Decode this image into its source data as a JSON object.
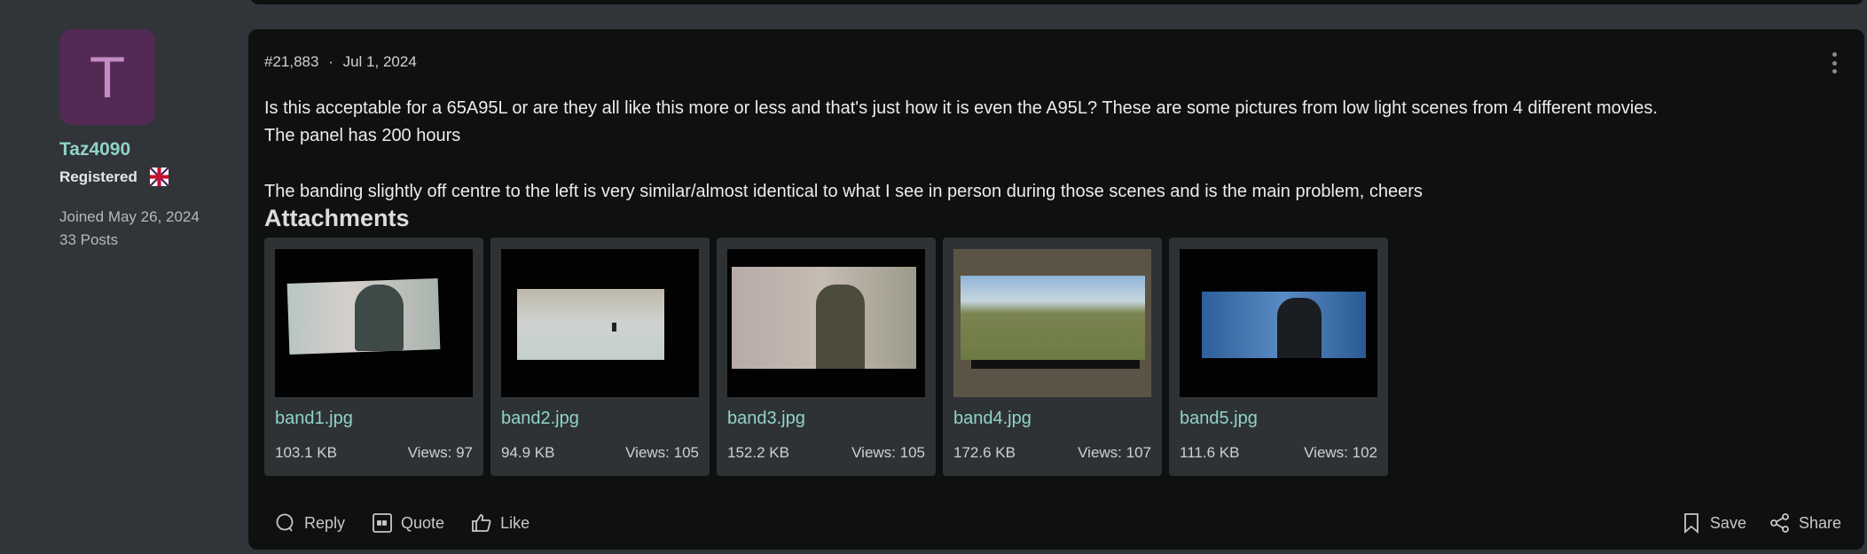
{
  "user": {
    "avatar_letter": "T",
    "avatar_color": "#532a53",
    "name": "Taz4090",
    "role": "Registered",
    "flag_icon": "uk-flag-icon",
    "joined": "Joined May 26, 2024",
    "posts": "33 Posts"
  },
  "post": {
    "number": "#21,883",
    "separator": "·",
    "date": "Jul 1, 2024",
    "body": [
      "Is this acceptable for a 65A95L or are they all like this more or less and that's just how it is even the A95L? These are some pictures from low light scenes from 4 different movies.",
      "The panel has 200 hours",
      "The banding slightly off centre to the left is very similar/almost identical to what I see in person during those scenes and is the main problem, cheers"
    ],
    "attachments_heading": "Attachments",
    "attachments": [
      {
        "name": "band1.jpg",
        "size": "103.1 KB",
        "views": "Views: 97"
      },
      {
        "name": "band2.jpg",
        "size": "94.9 KB",
        "views": "Views: 105"
      },
      {
        "name": "band3.jpg",
        "size": "152.2 KB",
        "views": "Views: 105"
      },
      {
        "name": "band4.jpg",
        "size": "172.6 KB",
        "views": "Views: 107"
      },
      {
        "name": "band5.jpg",
        "size": "111.6 KB",
        "views": "Views: 102"
      }
    ]
  },
  "actions": {
    "reply": "Reply",
    "quote": "Quote",
    "like": "Like",
    "save": "Save",
    "share": "Share"
  },
  "colors": {
    "accent": "#8fd3c9",
    "card": "#0f1010",
    "page": "#313438"
  }
}
